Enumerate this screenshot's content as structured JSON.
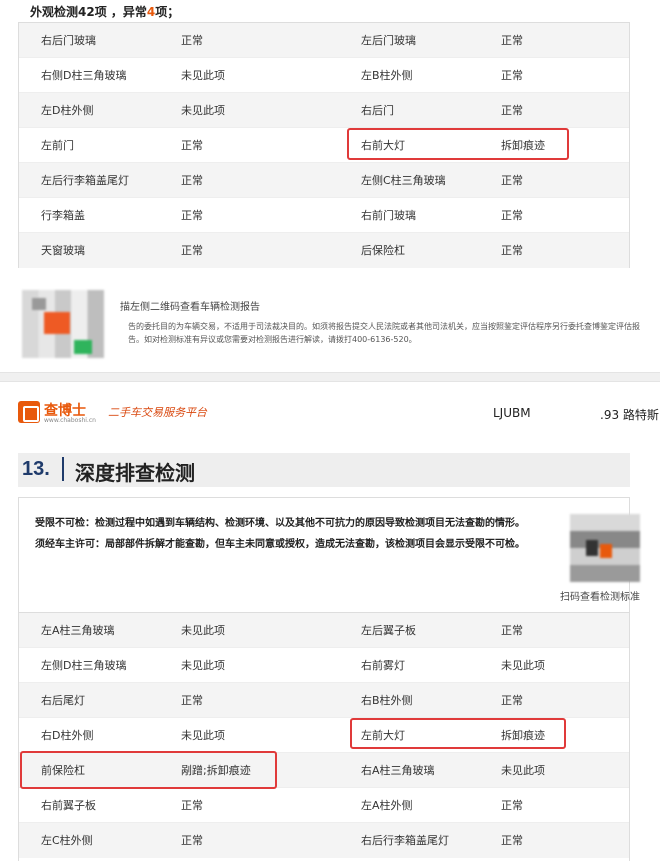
{
  "top": {
    "summary_prefix": "外观检测42项 ，异常",
    "summary_count": "4",
    "summary_suffix": "项；",
    "rows": [
      [
        "右后门玻璃",
        "正常",
        "左后门玻璃",
        "正常"
      ],
      [
        "右侧D柱三角玻璃",
        "未见此项",
        "左B柱外侧",
        "正常"
      ],
      [
        "左D柱外侧",
        "未见此项",
        "右后门",
        "正常"
      ],
      [
        "左前门",
        "正常",
        "右前大灯",
        "拆卸痕迹"
      ],
      [
        "左后行李箱盖尾灯",
        "正常",
        "左侧C柱三角玻璃",
        "正常"
      ],
      [
        "行李箱盖",
        "正常",
        "右前门玻璃",
        "正常"
      ],
      [
        "天窗玻璃",
        "正常",
        "后保险杠",
        "正常"
      ]
    ],
    "qr_caption": "描左侧二维码查看车辆检测报告",
    "disclaimer": "告的委托目的为车辆交易，不适用于司法裁决目的。如须将报告提交人民法院或者其他司法机关，应当按照鉴定评估程序另行委托查博鉴定评估报告。如对检测标准有异议或您需要对检测报告进行解读，请拨打400-6136-520。"
  },
  "header": {
    "brand": "查博士",
    "brand_url": "www.chaboshi.cn",
    "slogan": "二手车交易服务平台",
    "vin": "LJUBM",
    "car": ".93 路特斯"
  },
  "section": {
    "number": "13.",
    "title": "深度排查检测",
    "note1": "受限不可检：检测过程中如遇到车辆结构、检测环境、以及其他不可抗力的原因导致检测项目无法查勘的情形。",
    "note2": "须经车主许可：局部部件拆解才能查勘，但车主未同意或授权，造成无法查勘，该检测项目会显示受限不可检。",
    "qr_caption": "扫码查看检测标准",
    "rows": [
      [
        "左A柱三角玻璃",
        "未见此项",
        "左后翼子板",
        "正常"
      ],
      [
        "左侧D柱三角玻璃",
        "未见此项",
        "右前雾灯",
        "未见此项"
      ],
      [
        "右后尾灯",
        "正常",
        "右B柱外侧",
        "正常"
      ],
      [
        "右D柱外侧",
        "未见此项",
        "左前大灯",
        "拆卸痕迹"
      ],
      [
        "前保险杠",
        "剐蹭;拆卸痕迹",
        "右A柱三角玻璃",
        "未见此项"
      ],
      [
        "右前翼子板",
        "正常",
        "左A柱外侧",
        "正常"
      ],
      [
        "左C柱外侧",
        "正常",
        "右后行李箱盖尾灯",
        "正常"
      ]
    ]
  },
  "colors": {
    "accent": "#e8590c",
    "highlight_box": "#e03a3a",
    "section_blue": "#1f3b6b"
  }
}
